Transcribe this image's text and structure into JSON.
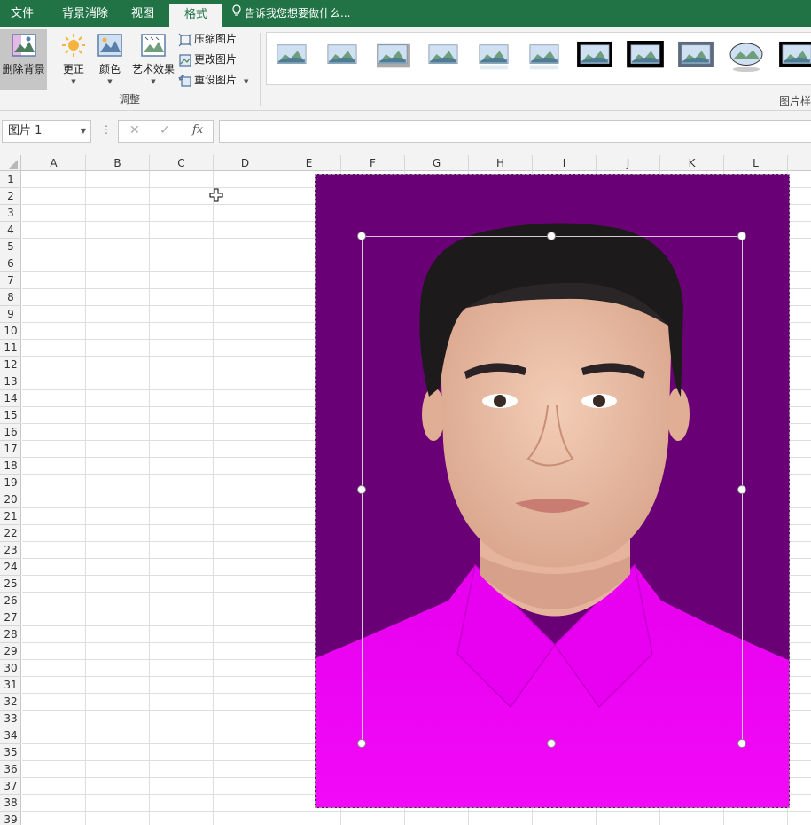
{
  "tabs": [
    {
      "label": "文件",
      "active": false
    },
    {
      "label": "背景消除",
      "active": false
    },
    {
      "label": "视图",
      "active": false
    },
    {
      "label": "格式",
      "active": true
    }
  ],
  "tell_me": "告诉我您想要做什么...",
  "ribbon": {
    "remove_bg": "删除背景",
    "corrections": "更正",
    "color": "颜色",
    "artistic": "艺术效果",
    "compress": "压缩图片",
    "change": "更改图片",
    "reset": "重设图片",
    "adjust_group": "调整",
    "styles_group": "图片样"
  },
  "formula_bar": {
    "name_box": "图片 1",
    "cancel_glyph": "✕",
    "enter_glyph": "✓",
    "fx_glyph": "fx",
    "value": ""
  },
  "columns": [
    "A",
    "B",
    "C",
    "D",
    "E",
    "F",
    "G",
    "H",
    "I",
    "J",
    "K",
    "L"
  ],
  "rows": [
    "1",
    "2",
    "3",
    "4",
    "5",
    "6",
    "7",
    "8",
    "9",
    "10",
    "11",
    "12",
    "13",
    "14",
    "15",
    "16",
    "17",
    "18",
    "19",
    "20",
    "21",
    "22",
    "23",
    "24",
    "25",
    "26",
    "27",
    "28",
    "29",
    "30",
    "31",
    "32",
    "33",
    "34",
    "35",
    "36",
    "37",
    "38",
    "39"
  ],
  "colors": {
    "accent": "#217346",
    "photo_background": "#6a0075",
    "shirt": "#f000f5"
  }
}
